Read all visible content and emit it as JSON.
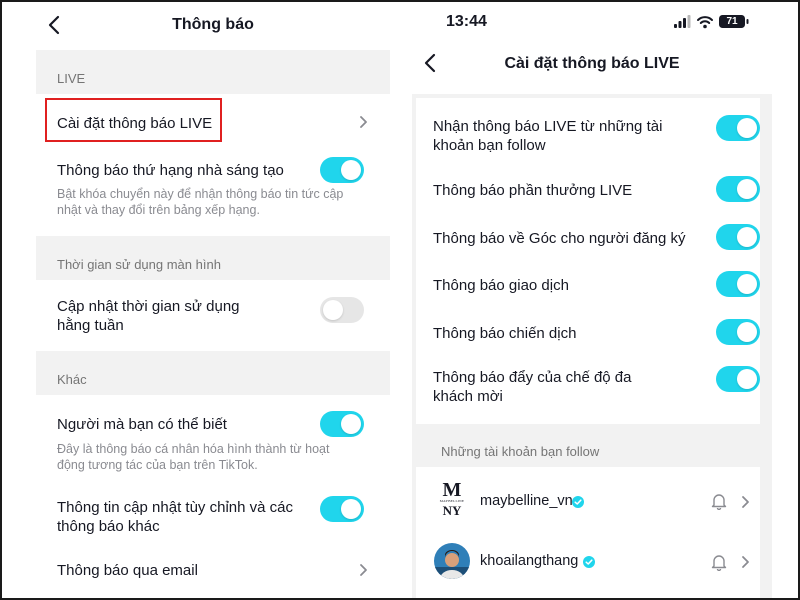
{
  "left_screen": {
    "header": {
      "title": "Thông báo"
    },
    "sections": {
      "live": "LIVE",
      "screen_time": "Thời gian sử dụng màn hình",
      "other": "Khác"
    },
    "live_settings": {
      "label": "Cài đặt thông báo LIVE"
    },
    "creator_ranking": {
      "label": "Thông báo thứ hạng nhà sáng tạo",
      "description_line1": "Bật khóa chuyển này để nhận thông báo tin tức cập",
      "description_line2": "nhật và thay đổi trên bảng xếp hạng.",
      "enabled": true
    },
    "weekly_screen_time": {
      "label_line1": "Cập nhật thời gian sử dụng",
      "label_line2": "hằng tuần",
      "enabled": false
    },
    "people_you_may_know": {
      "label": "Người mà bạn có thể biết",
      "description_line1": "Đây là thông báo cá nhân hóa hình thành từ hoạt",
      "description_line2": "động tương tác của bạn trên TikTok.",
      "enabled": true
    },
    "custom_updates": {
      "label_line1": "Thông tin cập nhật tùy chỉnh và các",
      "label_line2": "thông báo khác",
      "enabled": true
    },
    "email_notifications": {
      "label": "Thông báo qua email"
    }
  },
  "right_screen": {
    "status_bar": {
      "time": "13:44",
      "battery": "71"
    },
    "header": {
      "title": "Cài đặt thông báo LIVE"
    },
    "toggles": [
      {
        "line1": "Nhận thông báo LIVE từ những tài",
        "line2": "khoản bạn follow",
        "enabled": true
      },
      {
        "line1": "Thông báo phần thưởng LIVE",
        "line2": "",
        "enabled": true
      },
      {
        "line1": "Thông báo về Góc cho người đăng ký",
        "line2": "",
        "enabled": true
      },
      {
        "line1": "Thông báo giao dịch",
        "line2": "",
        "enabled": true
      },
      {
        "line1": "Thông báo chiến dịch",
        "line2": "",
        "enabled": true
      },
      {
        "line1": "Thông báo đẩy của chế độ đa",
        "line2": "khách mời",
        "enabled": true
      }
    ],
    "following_section": {
      "label": "Những tài khoản bạn follow"
    },
    "accounts": [
      {
        "name": "maybelline_vn",
        "logo_top": "M",
        "logo_mid": "MAYBELLINE",
        "logo_bottom": "NY"
      },
      {
        "name": "khoailangthang"
      }
    ]
  },
  "colors": {
    "toggle_on": "#20d5ec",
    "toggle_off": "#e6e6e6",
    "highlight_border": "#e02020",
    "verified_badge": "#20d5ec"
  },
  "icons": [
    "chevron-left-icon",
    "chevron-right-icon",
    "bell-icon",
    "verified-badge-icon",
    "signal-icon",
    "wifi-icon",
    "battery-icon"
  ]
}
